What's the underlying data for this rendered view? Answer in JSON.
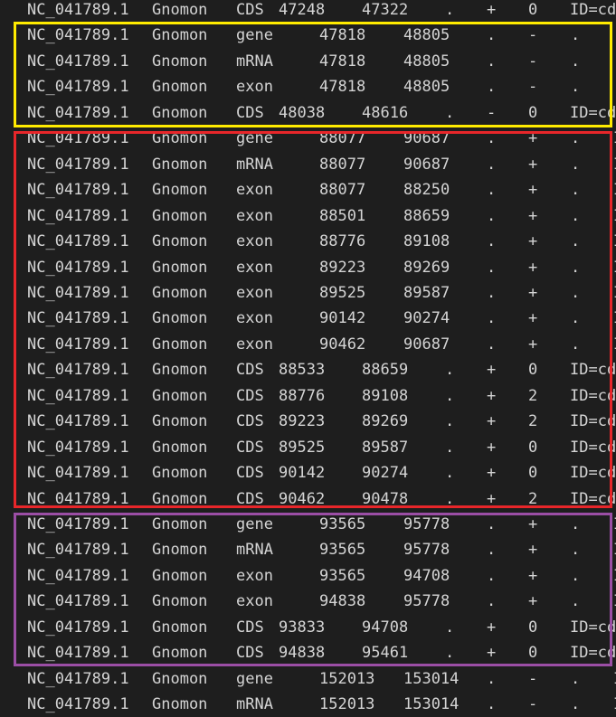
{
  "colors": {
    "background": "#1e1e1e",
    "text": "#d4d4d4",
    "box_yellow": "#ffeb00",
    "box_red": "#e8262a",
    "box_purple": "#9b4ea5"
  },
  "rows": [
    {
      "seq": "NC_041789.1",
      "src": "Gnomon",
      "type": "CDS",
      "start": "47248",
      "end": "47322",
      "score": ".",
      "strand": "+",
      "phase": "0",
      "attr": "ID=cds"
    },
    {
      "seq": "NC_041789.1",
      "src": "Gnomon",
      "type": "gene",
      "start": "47818",
      "end": "48805",
      "score": ".",
      "strand": "-",
      "phase": ".",
      "attr": ""
    },
    {
      "seq": "NC_041789.1",
      "src": "Gnomon",
      "type": "mRNA",
      "start": "47818",
      "end": "48805",
      "score": ".",
      "strand": "-",
      "phase": ".",
      "attr": ""
    },
    {
      "seq": "NC_041789.1",
      "src": "Gnomon",
      "type": "exon",
      "start": "47818",
      "end": "48805",
      "score": ".",
      "strand": "-",
      "phase": ".",
      "attr": ""
    },
    {
      "seq": "NC_041789.1",
      "src": "Gnomon",
      "type": "CDS",
      "start": "48038",
      "end": "48616",
      "score": ".",
      "strand": "-",
      "phase": "0",
      "attr": "ID=cds"
    },
    {
      "seq": "NC_041789.1",
      "src": "Gnomon",
      "type": "gene",
      "start": "88077",
      "end": "90687",
      "score": ".",
      "strand": "+",
      "phase": ".",
      "attr": "I"
    },
    {
      "seq": "NC_041789.1",
      "src": "Gnomon",
      "type": "mRNA",
      "start": "88077",
      "end": "90687",
      "score": ".",
      "strand": "+",
      "phase": ".",
      "attr": "I"
    },
    {
      "seq": "NC_041789.1",
      "src": "Gnomon",
      "type": "exon",
      "start": "88077",
      "end": "88250",
      "score": ".",
      "strand": "+",
      "phase": ".",
      "attr": "I"
    },
    {
      "seq": "NC_041789.1",
      "src": "Gnomon",
      "type": "exon",
      "start": "88501",
      "end": "88659",
      "score": ".",
      "strand": "+",
      "phase": ".",
      "attr": "I"
    },
    {
      "seq": "NC_041789.1",
      "src": "Gnomon",
      "type": "exon",
      "start": "88776",
      "end": "89108",
      "score": ".",
      "strand": "+",
      "phase": ".",
      "attr": "I"
    },
    {
      "seq": "NC_041789.1",
      "src": "Gnomon",
      "type": "exon",
      "start": "89223",
      "end": "89269",
      "score": ".",
      "strand": "+",
      "phase": ".",
      "attr": "I"
    },
    {
      "seq": "NC_041789.1",
      "src": "Gnomon",
      "type": "exon",
      "start": "89525",
      "end": "89587",
      "score": ".",
      "strand": "+",
      "phase": ".",
      "attr": "I"
    },
    {
      "seq": "NC_041789.1",
      "src": "Gnomon",
      "type": "exon",
      "start": "90142",
      "end": "90274",
      "score": ".",
      "strand": "+",
      "phase": ".",
      "attr": "I"
    },
    {
      "seq": "NC_041789.1",
      "src": "Gnomon",
      "type": "exon",
      "start": "90462",
      "end": "90687",
      "score": ".",
      "strand": "+",
      "phase": ".",
      "attr": "I"
    },
    {
      "seq": "NC_041789.1",
      "src": "Gnomon",
      "type": "CDS",
      "start": "88533",
      "end": "88659",
      "score": ".",
      "strand": "+",
      "phase": "0",
      "attr": "ID=cd"
    },
    {
      "seq": "NC_041789.1",
      "src": "Gnomon",
      "type": "CDS",
      "start": "88776",
      "end": "89108",
      "score": ".",
      "strand": "+",
      "phase": "2",
      "attr": "ID=cd"
    },
    {
      "seq": "NC_041789.1",
      "src": "Gnomon",
      "type": "CDS",
      "start": "89223",
      "end": "89269",
      "score": ".",
      "strand": "+",
      "phase": "2",
      "attr": "ID=cd"
    },
    {
      "seq": "NC_041789.1",
      "src": "Gnomon",
      "type": "CDS",
      "start": "89525",
      "end": "89587",
      "score": ".",
      "strand": "+",
      "phase": "0",
      "attr": "ID=cd"
    },
    {
      "seq": "NC_041789.1",
      "src": "Gnomon",
      "type": "CDS",
      "start": "90142",
      "end": "90274",
      "score": ".",
      "strand": "+",
      "phase": "0",
      "attr": "ID=cd"
    },
    {
      "seq": "NC_041789.1",
      "src": "Gnomon",
      "type": "CDS",
      "start": "90462",
      "end": "90478",
      "score": ".",
      "strand": "+",
      "phase": "2",
      "attr": "ID=cd"
    },
    {
      "seq": "NC_041789.1",
      "src": "Gnomon",
      "type": "gene",
      "start": "93565",
      "end": "95778",
      "score": ".",
      "strand": "+",
      "phase": ".",
      "attr": "I"
    },
    {
      "seq": "NC_041789.1",
      "src": "Gnomon",
      "type": "mRNA",
      "start": "93565",
      "end": "95778",
      "score": ".",
      "strand": "+",
      "phase": ".",
      "attr": "I"
    },
    {
      "seq": "NC_041789.1",
      "src": "Gnomon",
      "type": "exon",
      "start": "93565",
      "end": "94708",
      "score": ".",
      "strand": "+",
      "phase": ".",
      "attr": "I"
    },
    {
      "seq": "NC_041789.1",
      "src": "Gnomon",
      "type": "exon",
      "start": "94838",
      "end": "95778",
      "score": ".",
      "strand": "+",
      "phase": ".",
      "attr": "I"
    },
    {
      "seq": "NC_041789.1",
      "src": "Gnomon",
      "type": "CDS",
      "start": "93833",
      "end": "94708",
      "score": ".",
      "strand": "+",
      "phase": "0",
      "attr": "ID=cd"
    },
    {
      "seq": "NC_041789.1",
      "src": "Gnomon",
      "type": "CDS",
      "start": "94838",
      "end": "95461",
      "score": ".",
      "strand": "+",
      "phase": "0",
      "attr": "ID=cd"
    },
    {
      "seq": "NC_041789.1",
      "src": "Gnomon",
      "type": "gene",
      "start": "152013",
      "end": "153014",
      "score": ".",
      "strand": "-",
      "phase": ".",
      "attr": "I"
    },
    {
      "seq": "NC_041789.1",
      "src": "Gnomon",
      "type": "mRNA",
      "start": "152013",
      "end": "153014",
      "score": ".",
      "strand": "-",
      "phase": ".",
      "attr": "I"
    }
  ]
}
